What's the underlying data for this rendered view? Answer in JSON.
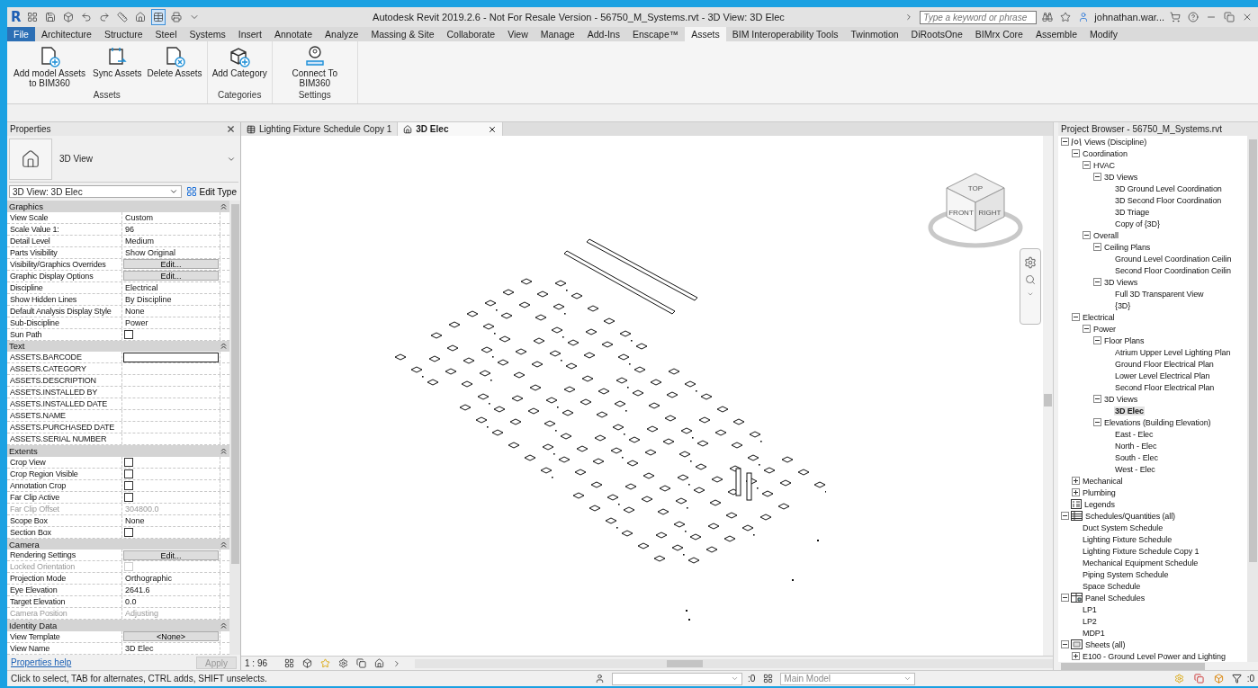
{
  "window": {
    "title": "Autodesk Revit 2019.2.6 - Not For Resale Version - 56750_M_Systems.rvt - 3D View: 3D Elec",
    "app_logo": "R"
  },
  "search": {
    "placeholder": "Type a keyword or phrase"
  },
  "user": {
    "name": "johnathan.war..."
  },
  "ribbon_tabs": [
    {
      "label": "File",
      "kind": "file",
      "selected": false
    },
    {
      "label": "Architecture",
      "selected": false
    },
    {
      "label": "Structure",
      "selected": false
    },
    {
      "label": "Steel",
      "selected": false
    },
    {
      "label": "Systems",
      "selected": false
    },
    {
      "label": "Insert",
      "selected": false
    },
    {
      "label": "Annotate",
      "selected": false
    },
    {
      "label": "Analyze",
      "selected": false
    },
    {
      "label": "Massing & Site",
      "selected": false
    },
    {
      "label": "Collaborate",
      "selected": false
    },
    {
      "label": "View",
      "selected": false
    },
    {
      "label": "Manage",
      "selected": false
    },
    {
      "label": "Add-Ins",
      "selected": false
    },
    {
      "label": "Enscape™",
      "selected": false
    },
    {
      "label": "Assets",
      "selected": true
    },
    {
      "label": "BIM Interoperability Tools",
      "selected": false
    },
    {
      "label": "Twinmotion",
      "selected": false
    },
    {
      "label": "DiRootsOne",
      "selected": false
    },
    {
      "label": "BIMrx Core",
      "selected": false
    },
    {
      "label": "Assemble",
      "selected": false
    },
    {
      "label": "Modify",
      "selected": false
    }
  ],
  "ribbon_panels": [
    {
      "title": "Assets",
      "buttons": [
        {
          "label": "Add model Assets to BIM360",
          "kind": "add"
        },
        {
          "label": "Sync Assets",
          "kind": "sync"
        },
        {
          "label": "Delete Assets",
          "kind": "delete"
        }
      ]
    },
    {
      "title": "Categories",
      "buttons": [
        {
          "label": "Add Category",
          "kind": "category"
        }
      ]
    },
    {
      "title": "Settings",
      "buttons": [
        {
          "label": "Connect To BIM360",
          "kind": "connect"
        }
      ]
    }
  ],
  "properties": {
    "title": "Properties",
    "type_name": "3D View",
    "instance": "3D View: 3D Elec",
    "edit_type": "Edit Type",
    "groups": [
      {
        "title": "Graphics",
        "rows": [
          {
            "label": "View Scale",
            "value": "Custom",
            "kind": "text",
            "disabled": false
          },
          {
            "label": "Scale Value    1:",
            "value": "96",
            "kind": "text",
            "disabled": false
          },
          {
            "label": "Detail Level",
            "value": "Medium",
            "kind": "text",
            "disabled": false
          },
          {
            "label": "Parts Visibility",
            "value": "Show Original",
            "kind": "text",
            "disabled": false
          },
          {
            "label": "Visibility/Graphics Overrides",
            "value": "Edit...",
            "kind": "button",
            "disabled": false
          },
          {
            "label": "Graphic Display Options",
            "value": "Edit...",
            "kind": "button",
            "disabled": false
          },
          {
            "label": "Discipline",
            "value": "Electrical",
            "kind": "text",
            "disabled": false
          },
          {
            "label": "Show Hidden Lines",
            "value": "By Discipline",
            "kind": "text",
            "disabled": false
          },
          {
            "label": "Default Analysis Display Style",
            "value": "None",
            "kind": "text",
            "disabled": false
          },
          {
            "label": "Sub-Discipline",
            "value": "Power",
            "kind": "text",
            "disabled": false
          },
          {
            "label": "Sun Path",
            "kind": "checkbox",
            "checked": false,
            "disabled": false
          }
        ]
      },
      {
        "title": "Text",
        "rows": [
          {
            "label": "ASSETS.BARCODE",
            "kind": "field",
            "disabled": false
          },
          {
            "label": "ASSETS.CATEGORY",
            "kind": "text",
            "disabled": false
          },
          {
            "label": "ASSETS.DESCRIPTION",
            "kind": "text",
            "disabled": false
          },
          {
            "label": "ASSETS.INSTALLED BY",
            "kind": "text",
            "disabled": false
          },
          {
            "label": "ASSETS.INSTALLED DATE",
            "kind": "text",
            "disabled": false
          },
          {
            "label": "ASSETS.NAME",
            "kind": "text",
            "disabled": false
          },
          {
            "label": "ASSETS.PURCHASED DATE",
            "kind": "text",
            "disabled": false
          },
          {
            "label": "ASSETS.SERIAL NUMBER",
            "kind": "text",
            "disabled": false
          }
        ]
      },
      {
        "title": "Extents",
        "rows": [
          {
            "label": "Crop View",
            "kind": "checkbox",
            "checked": false,
            "disabled": false
          },
          {
            "label": "Crop Region Visible",
            "kind": "checkbox",
            "checked": false,
            "disabled": false
          },
          {
            "label": "Annotation Crop",
            "kind": "checkbox",
            "checked": false,
            "disabled": false
          },
          {
            "label": "Far Clip Active",
            "kind": "checkbox",
            "checked": false,
            "disabled": false
          },
          {
            "label": "Far Clip Offset",
            "value": "304800.0",
            "kind": "text",
            "disabled": true
          },
          {
            "label": "Scope Box",
            "value": "None",
            "kind": "text",
            "disabled": false
          },
          {
            "label": "Section Box",
            "kind": "checkbox",
            "checked": false,
            "disabled": false
          }
        ]
      },
      {
        "title": "Camera",
        "rows": [
          {
            "label": "Rendering Settings",
            "value": "Edit...",
            "kind": "button",
            "disabled": false
          },
          {
            "label": "Locked Orientation",
            "kind": "checkbox",
            "checked": false,
            "disabled": true
          },
          {
            "label": "Projection Mode",
            "value": "Orthographic",
            "kind": "text",
            "disabled": false
          },
          {
            "label": "Eye Elevation",
            "value": "2641.6",
            "kind": "text",
            "disabled": false
          },
          {
            "label": "Target Elevation",
            "value": "0.0",
            "kind": "text",
            "disabled": false
          },
          {
            "label": "Camera Position",
            "value": "Adjusting",
            "kind": "text",
            "disabled": true
          }
        ]
      },
      {
        "title": "Identity Data",
        "rows": [
          {
            "label": "View Template",
            "value": "<None>",
            "kind": "button",
            "disabled": false
          },
          {
            "label": "View Name",
            "value": "3D Elec",
            "kind": "text",
            "disabled": false
          }
        ]
      }
    ],
    "help_link": "Properties help",
    "apply": {
      "label": "Apply",
      "disabled": true
    }
  },
  "view_tabs": [
    {
      "label": "Lighting Fixture Schedule Copy 1",
      "kind": "schedule",
      "selected": false
    },
    {
      "label": "3D Elec",
      "kind": "model",
      "selected": true
    }
  ],
  "view_cube": {
    "top": "TOP",
    "front": "FRONT",
    "right": "RIGHT"
  },
  "view_control": {
    "scale": "1 : 96"
  },
  "project_browser": {
    "title": "Project Browser - 56750_M_Systems.rvt",
    "tree": [
      {
        "label": "Views (Discipline)",
        "kind": "views",
        "expanded": true,
        "selected": false,
        "children": [
          {
            "label": "Coordination",
            "expanded": true,
            "selected": false,
            "children": [
              {
                "label": "HVAC",
                "expanded": true,
                "selected": false,
                "children": [
                  {
                    "label": "3D Views",
                    "expanded": true,
                    "selected": false,
                    "children": [
                      {
                        "label": "3D Ground Level Coordination",
                        "selected": false
                      },
                      {
                        "label": "3D Second Floor Coordination",
                        "selected": false
                      },
                      {
                        "label": "3D Triage",
                        "selected": false
                      },
                      {
                        "label": "Copy of {3D}",
                        "selected": false
                      }
                    ]
                  }
                ]
              },
              {
                "label": "Overall",
                "expanded": true,
                "selected": false,
                "children": [
                  {
                    "label": "Ceiling Plans",
                    "expanded": true,
                    "selected": false,
                    "children": [
                      {
                        "label": "Ground Level Coordination Ceilin",
                        "selected": false
                      },
                      {
                        "label": "Second Floor Coordination Ceilin",
                        "selected": false
                      }
                    ]
                  },
                  {
                    "label": "3D Views",
                    "expanded": true,
                    "selected": false,
                    "children": [
                      {
                        "label": "Full 3D Transparent View",
                        "selected": false
                      },
                      {
                        "label": "{3D}",
                        "selected": false
                      }
                    ]
                  }
                ]
              }
            ]
          },
          {
            "label": "Electrical",
            "expanded": true,
            "selected": false,
            "children": [
              {
                "label": "Power",
                "expanded": true,
                "selected": false,
                "children": [
                  {
                    "label": "Floor Plans",
                    "expanded": true,
                    "selected": false,
                    "children": [
                      {
                        "label": "Atrium Upper Level Lighting Plan",
                        "selected": false
                      },
                      {
                        "label": "Ground Floor Electrical Plan",
                        "selected": false
                      },
                      {
                        "label": "Lower Level Electrical Plan",
                        "selected": false
                      },
                      {
                        "label": "Second Floor Electrical Plan",
                        "selected": false
                      }
                    ]
                  },
                  {
                    "label": "3D Views",
                    "expanded": true,
                    "selected": false,
                    "children": [
                      {
                        "label": "3D Elec",
                        "selected": true
                      }
                    ]
                  },
                  {
                    "label": "Elevations (Building Elevation)",
                    "expanded": true,
                    "selected": false,
                    "children": [
                      {
                        "label": "East - Elec",
                        "selected": false
                      },
                      {
                        "label": "North - Elec",
                        "selected": false
                      },
                      {
                        "label": "South - Elec",
                        "selected": false
                      },
                      {
                        "label": "West - Elec",
                        "selected": false
                      }
                    ]
                  }
                ]
              }
            ]
          },
          {
            "label": "Mechanical",
            "expanded": false,
            "selected": false
          },
          {
            "label": "Plumbing",
            "expanded": false,
            "selected": false
          }
        ]
      },
      {
        "label": "Legends",
        "kind": "legends",
        "selected": false
      },
      {
        "label": "Schedules/Quantities (all)",
        "kind": "schedules",
        "expanded": true,
        "selected": false,
        "children": [
          {
            "label": "Duct System Schedule",
            "selected": false
          },
          {
            "label": "Lighting Fixture Schedule",
            "selected": false
          },
          {
            "label": "Lighting Fixture Schedule Copy 1",
            "selected": false
          },
          {
            "label": "Mechanical Equipment Schedule",
            "selected": false
          },
          {
            "label": "Piping System Schedule",
            "selected": false
          },
          {
            "label": "Space Schedule",
            "selected": false
          }
        ]
      },
      {
        "label": "Panel Schedules",
        "kind": "panels",
        "expanded": true,
        "selected": false,
        "children": [
          {
            "label": "LP1",
            "selected": false
          },
          {
            "label": "LP2",
            "selected": false
          },
          {
            "label": "MDP1",
            "selected": false
          }
        ]
      },
      {
        "label": "Sheets (all)",
        "kind": "sheets",
        "expanded": true,
        "selected": false,
        "children": [
          {
            "label": "E100 - Ground Level Power and Lighting",
            "expanded": false,
            "selected": false
          }
        ]
      }
    ]
  },
  "status_bar": {
    "message": "Click to select, TAB for alternates, CTRL adds, SHIFT unselects.",
    "workset_count": ":0",
    "model": "Main Model",
    "filter_count": ":0"
  }
}
